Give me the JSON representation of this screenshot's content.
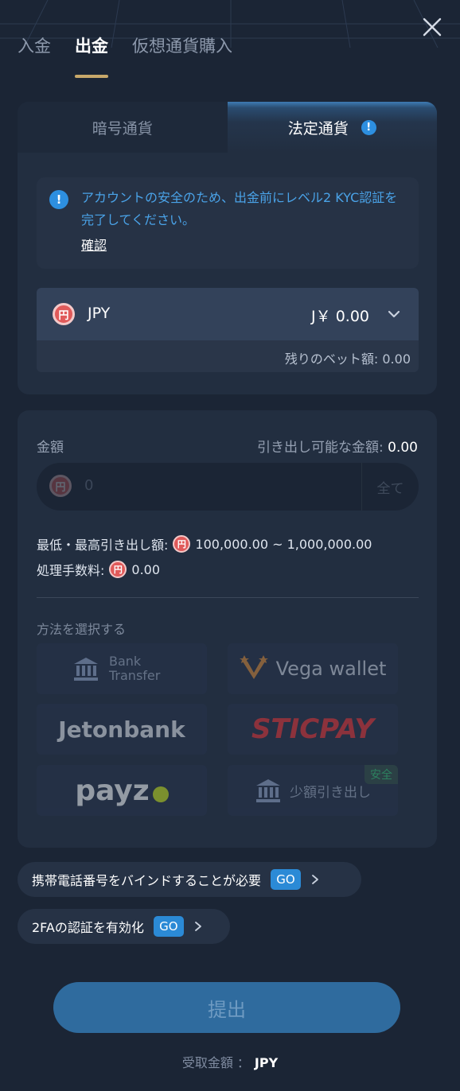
{
  "top_tabs": [
    {
      "label": "入金",
      "active": false
    },
    {
      "label": "出金",
      "active": true
    },
    {
      "label": "仮想通貨購入",
      "active": false
    }
  ],
  "segment": {
    "crypto": "暗号通貨",
    "fiat": "法定通貨",
    "info_icon": "info-icon"
  },
  "kyc": {
    "message": "アカウントの安全のため、出金前にレベル2 KYC認証を完了してください。",
    "link": "確認"
  },
  "currency": {
    "icon_glyph": "円",
    "code": "JPY",
    "amount": "J￥ 0.00",
    "remaining_bet": "残りのベット額: 0.00"
  },
  "amount_section": {
    "label": "金額",
    "available_label": "引き出し可能な金額:",
    "available_value": "0.00",
    "input_placeholder": "0",
    "all_button": "全て",
    "limits_label": "最低・最高引き出し額:",
    "limits_value": "100,000.00 ~ 1,000,000.00",
    "fee_label": "処理手数料:",
    "fee_value": "0.00"
  },
  "methods": {
    "label": "方法を選択する",
    "bank_transfer": "Bank Transfer",
    "vega": "Vega wallet",
    "jetonbank": "Jetonbank",
    "sticpay": "STICPAY",
    "payz": "payz",
    "small": "少額引き出し",
    "safe_badge": "安全"
  },
  "prompts": {
    "phone": "携帯電話番号をバインドすることが必要",
    "twofa": "2FAの認証を有効化",
    "go": "GO"
  },
  "submit": "提出",
  "receive": {
    "label": "受取金額 ：",
    "currency": "JPY"
  },
  "colors": {
    "background": "#1b2535",
    "card": "#222e40",
    "accent_blue": "#2d8fe0",
    "tab_underline": "#c7a86a",
    "sticpay_red": "#e3363a",
    "safe_green": "#35c47a"
  }
}
